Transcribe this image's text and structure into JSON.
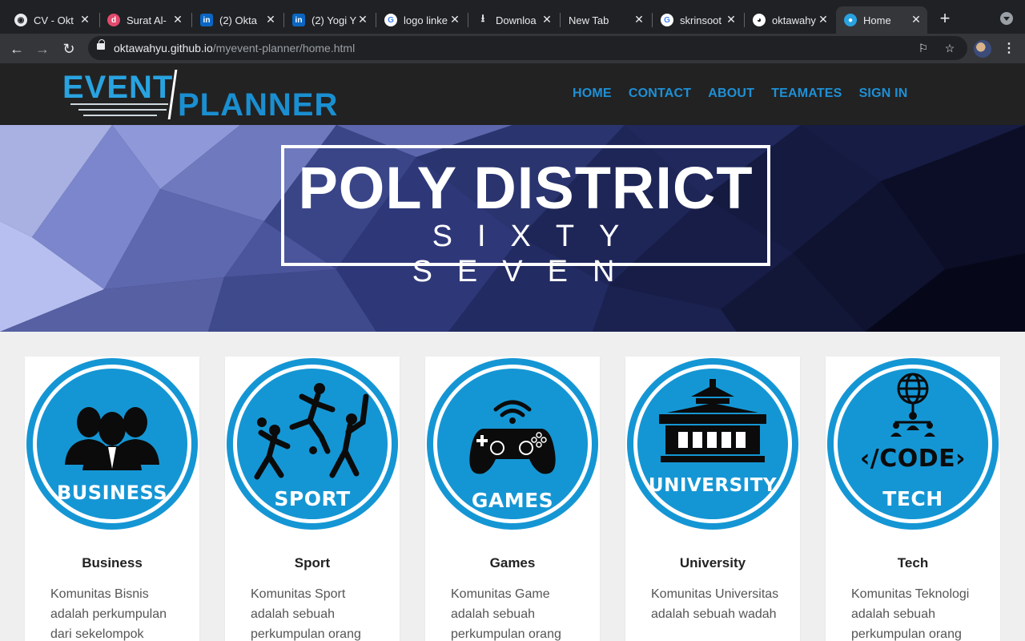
{
  "browser": {
    "tabs": [
      {
        "title": "CV - Okt",
        "favicon": "globe-icon",
        "color": "#e8eaed"
      },
      {
        "title": "Surat Al-",
        "favicon": "d-logo-icon",
        "color": "#e24a6d"
      },
      {
        "title": "(2) Okta",
        "favicon": "linkedin-icon",
        "color": "#0a66c2"
      },
      {
        "title": "(2) Yogi Y",
        "favicon": "linkedin-icon",
        "color": "#0a66c2"
      },
      {
        "title": "logo linke",
        "favicon": "google-icon",
        "color": "#ffffff"
      },
      {
        "title": "Downloa",
        "favicon": "download-icon",
        "color": "#e8eaed"
      },
      {
        "title": "New Tab",
        "favicon": "",
        "color": ""
      },
      {
        "title": "skrinsoot",
        "favicon": "google-icon",
        "color": "#ffffff"
      },
      {
        "title": "oktawahy",
        "favicon": "github-icon",
        "color": "#ffffff"
      },
      {
        "title": "Home",
        "favicon": "site-icon",
        "color": "#29a3e0"
      }
    ],
    "url_host": "oktawahyu.github.io",
    "url_path": "/myevent-planner/home.html"
  },
  "site": {
    "logo": {
      "top": "EVENT",
      "bottom": "PLANNER"
    },
    "nav": [
      "HOME",
      "CONTACT",
      "ABOUT",
      "TEAMATES",
      "SIGN IN"
    ],
    "hero": {
      "title": "POLY DISTRICT",
      "subtitle": "SIXTY SEVEN"
    },
    "accent": "#1e90d6",
    "cards": [
      {
        "badge": "BUSINESS",
        "title": "Business",
        "desc": "Komunitas Bisnis adalah perkumpulan dari sekelompok",
        "icon": "business-people-icon"
      },
      {
        "badge": "SPORT",
        "title": "Sport",
        "desc": "Komunitas Sport adalah sebuah perkumpulan orang",
        "icon": "sport-players-icon"
      },
      {
        "badge": "GAMES",
        "title": "Games",
        "desc": "Komunitas Game adalah sebuah perkumpulan orang",
        "icon": "gamepad-icon"
      },
      {
        "badge": "UNIVERSITY",
        "title": "University",
        "desc": "Komunitas Universitas adalah sebuah wadah",
        "icon": "university-building-icon"
      },
      {
        "badge": "TECH",
        "title": "Tech",
        "desc": "Komunitas Teknologi adalah sebuah perkumpulan orang",
        "icon": "code-network-icon"
      }
    ]
  }
}
